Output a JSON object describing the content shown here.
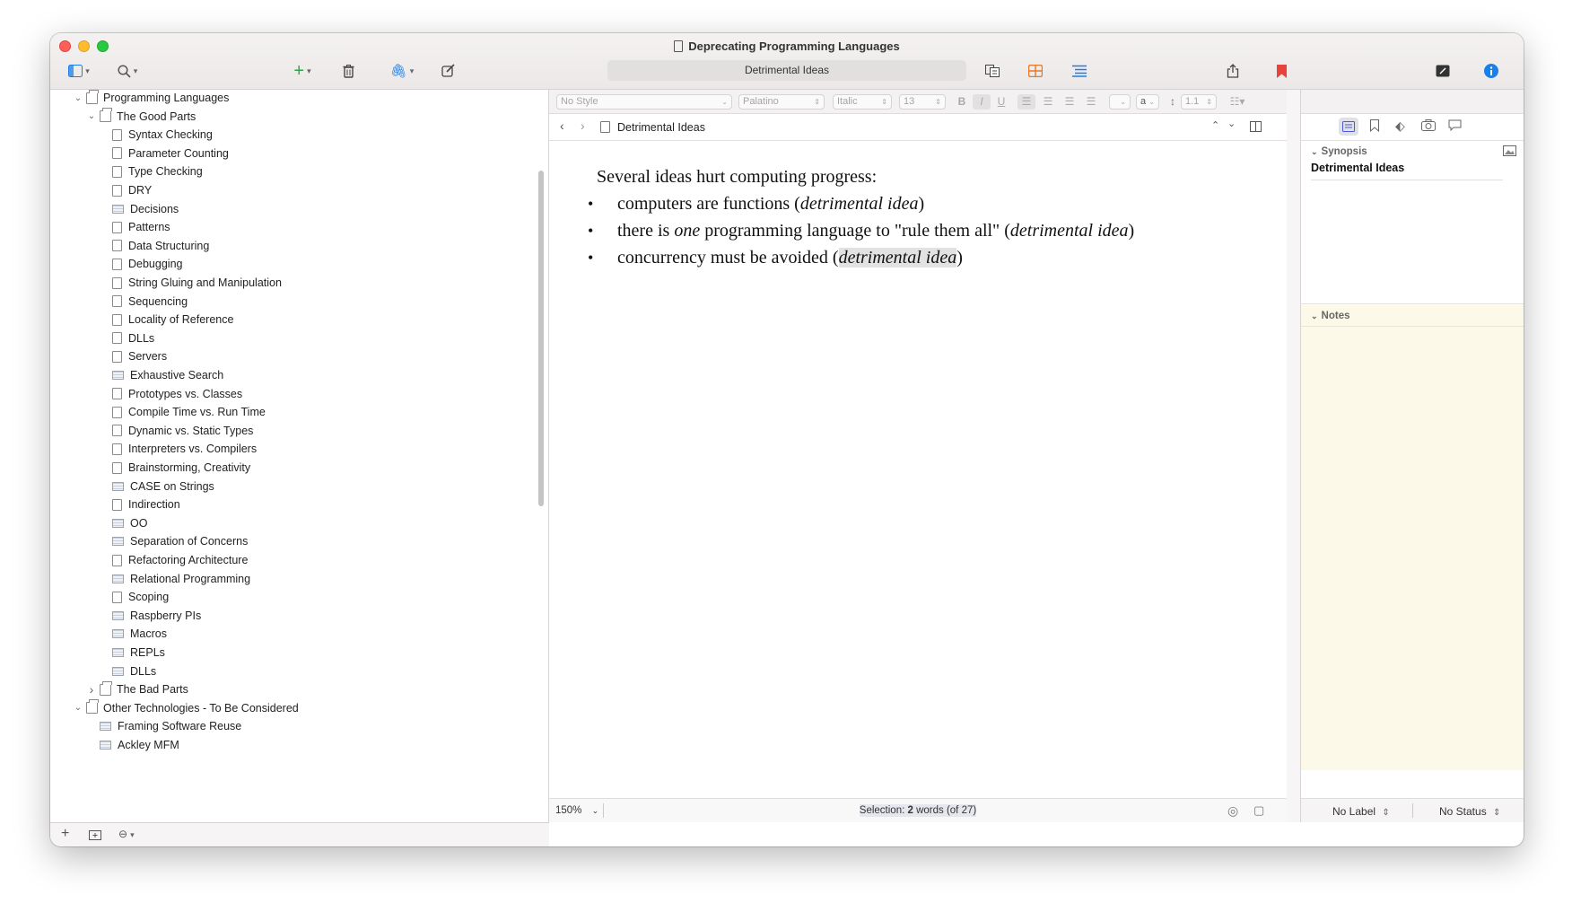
{
  "window": {
    "title": "Deprecating Programming Languages",
    "search_text": "Detrimental Ideas"
  },
  "binder": {
    "items": [
      {
        "label": "Programming Languages",
        "indent": 0,
        "disclosure": "open",
        "icon": "folder-icon"
      },
      {
        "label": "The Good Parts",
        "indent": 1,
        "disclosure": "open",
        "icon": "folder-icon"
      },
      {
        "label": "Syntax Checking",
        "indent": 2,
        "icon": "document-icon"
      },
      {
        "label": "Parameter Counting",
        "indent": 2,
        "icon": "document-icon"
      },
      {
        "label": "Type Checking",
        "indent": 2,
        "icon": "document-icon"
      },
      {
        "label": "DRY",
        "indent": 2,
        "icon": "document-icon"
      },
      {
        "label": "Decisions",
        "indent": 2,
        "icon": "text-icon"
      },
      {
        "label": "Patterns",
        "indent": 2,
        "icon": "document-icon"
      },
      {
        "label": "Data Structuring",
        "indent": 2,
        "icon": "document-icon"
      },
      {
        "label": "Debugging",
        "indent": 2,
        "icon": "document-icon"
      },
      {
        "label": "String Gluing and Manipulation",
        "indent": 2,
        "icon": "document-icon"
      },
      {
        "label": "Sequencing",
        "indent": 2,
        "icon": "document-icon"
      },
      {
        "label": "Locality of Reference",
        "indent": 2,
        "icon": "document-icon"
      },
      {
        "label": "DLLs",
        "indent": 2,
        "icon": "document-icon"
      },
      {
        "label": "Servers",
        "indent": 2,
        "icon": "document-icon"
      },
      {
        "label": "Exhaustive Search",
        "indent": 2,
        "icon": "text-icon"
      },
      {
        "label": "Prototypes vs. Classes",
        "indent": 2,
        "icon": "document-icon"
      },
      {
        "label": "Compile Time vs. Run Time",
        "indent": 2,
        "icon": "document-icon"
      },
      {
        "label": "Dynamic vs. Static Types",
        "indent": 2,
        "icon": "document-icon"
      },
      {
        "label": "Interpreters vs. Compilers",
        "indent": 2,
        "icon": "document-icon"
      },
      {
        "label": "Brainstorming, Creativity",
        "indent": 2,
        "icon": "document-icon"
      },
      {
        "label": "CASE on Strings",
        "indent": 2,
        "icon": "text-icon"
      },
      {
        "label": "Indirection",
        "indent": 2,
        "icon": "document-icon"
      },
      {
        "label": "OO",
        "indent": 2,
        "icon": "text-icon"
      },
      {
        "label": "Separation of Concerns",
        "indent": 2,
        "icon": "text-icon"
      },
      {
        "label": "Refactoring Architecture",
        "indent": 2,
        "icon": "document-icon"
      },
      {
        "label": "Relational Programming",
        "indent": 2,
        "icon": "text-icon"
      },
      {
        "label": "Scoping",
        "indent": 2,
        "icon": "document-icon"
      },
      {
        "label": "Raspberry PIs",
        "indent": 2,
        "icon": "text-icon"
      },
      {
        "label": "Macros",
        "indent": 2,
        "icon": "text-icon"
      },
      {
        "label": "REPLs",
        "indent": 2,
        "icon": "text-icon"
      },
      {
        "label": "DLLs",
        "indent": 2,
        "icon": "text-icon"
      },
      {
        "label": "The Bad Parts",
        "indent": 1,
        "disclosure": "closed",
        "icon": "folder-icon"
      },
      {
        "label": "Other Technologies - To Be Considered",
        "indent": 0,
        "disclosure": "open",
        "icon": "folder-icon"
      },
      {
        "label": "Framing Software Reuse",
        "indent": 1,
        "icon": "text-icon"
      },
      {
        "label": "Ackley MFM",
        "indent": 1,
        "icon": "text-icon"
      }
    ]
  },
  "format_bar": {
    "style": "No Style",
    "font": "Palatino",
    "typeface": "Italic",
    "size": "13",
    "bold": "B",
    "italic": "I",
    "underline": "U",
    "highlight_letter": "a",
    "line_spacing": "1.1"
  },
  "editor": {
    "header_title": "Detrimental Ideas",
    "intro": "Several ideas hurt computing progress:",
    "bullets": [
      {
        "pre": "computers are functions (",
        "em": "detrimental idea",
        "post": ")"
      },
      {
        "pre": "there is ",
        "em1": "one",
        "mid": " programming language to \"rule them all\" (",
        "em": "detrimental idea",
        "post": ")"
      },
      {
        "pre": "concurrency must be avoided (",
        "em": "detrimental idea",
        "post": ")"
      }
    ],
    "zoom": "150%",
    "selection_prefix": "Selection: ",
    "selection_count": "2",
    "selection_suffix": " words (of 27)"
  },
  "inspector": {
    "synopsis_label": "Synopsis",
    "synopsis_title": "Detrimental Ideas",
    "notes_label": "Notes",
    "label_value": "No Label",
    "status_value": "No Status"
  },
  "colors": {
    "accent_blue": "#1a7fe8",
    "add_green": "#2aa84a",
    "bookmark_red": "#e8433a",
    "corkboard_orange": "#e5782a",
    "notes_bg": "#fcf9e8"
  }
}
